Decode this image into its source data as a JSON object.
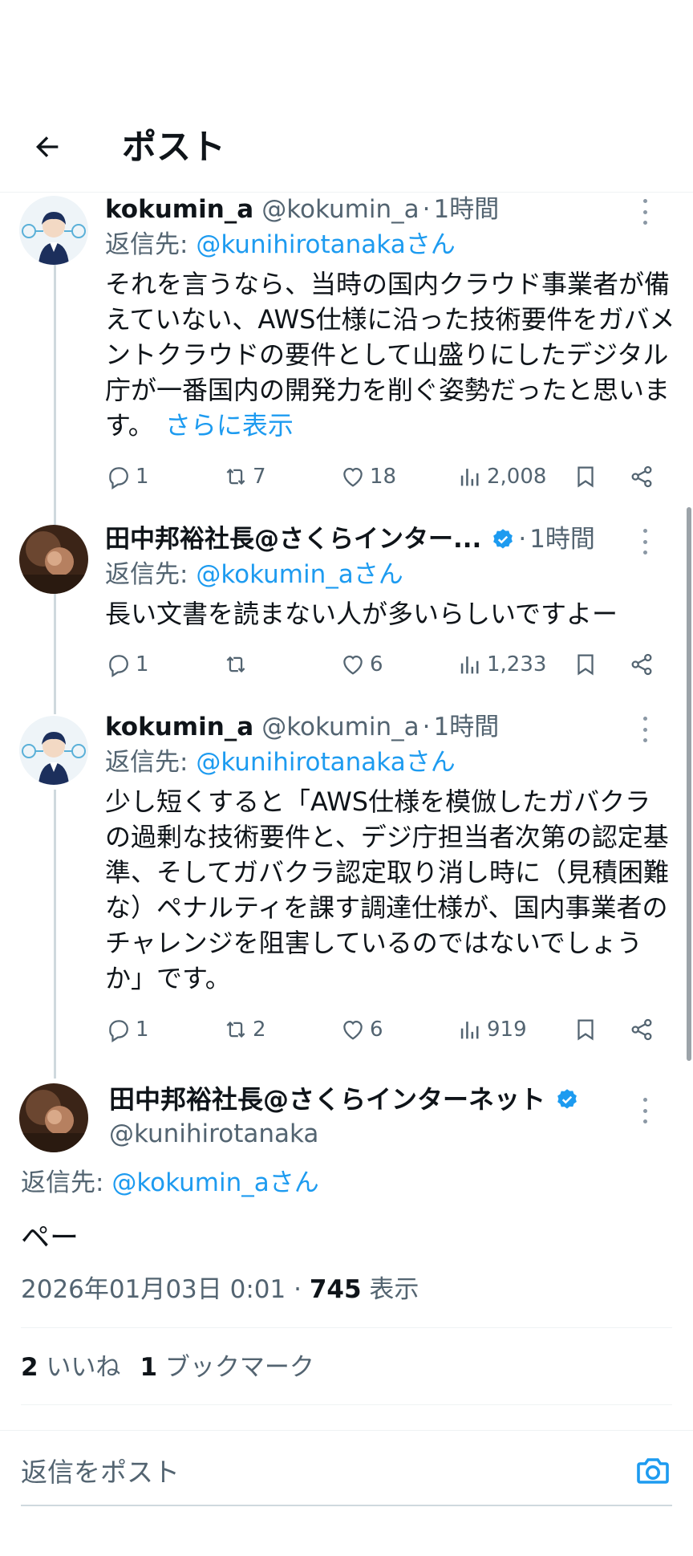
{
  "header": {
    "title": "ポスト",
    "back_icon": "arrow-left-icon"
  },
  "colors": {
    "link": "#1d9bf0",
    "muted": "#536471",
    "text": "#0f1419",
    "verified": "#1d9bf0"
  },
  "thread": [
    {
      "name": "kokumin_a",
      "handle": "@kokumin_a",
      "dot": "·",
      "time": "1時間",
      "reply_prefix": "返信先: ",
      "reply_mention": "@kunihirotanakaさん",
      "text": "それを言うなら、当時の国内クラウド事業者が備えていない、AWS仕様に沿った技術要件をガバメントクラウドの要件として山盛りにしたデジタル庁が一番国内の開発力を削ぐ姿勢だったと思います。",
      "show_more": "さらに表示",
      "replies": "1",
      "reposts": "7",
      "likes": "18",
      "views": "2,008"
    },
    {
      "name": "田中邦裕社長@さくらインター...",
      "handle": "",
      "dot": "·",
      "time": "1時間",
      "reply_prefix": "返信先: ",
      "reply_mention": "@kokumin_aさん",
      "text": "長い文書を読まない人が多いらしいですよー",
      "replies": "1",
      "reposts": "",
      "likes": "6",
      "views": "1,233"
    },
    {
      "name": "kokumin_a",
      "handle": "@kokumin_a",
      "dot": "·",
      "time": "1時間",
      "reply_prefix": "返信先: ",
      "reply_mention": "@kunihirotanakaさん",
      "text": "少し短くすると「AWS仕様を模倣したガバクラの過剰な技術要件と、デジ庁担当者次第の認定基準、そしてガバクラ認定取り消し時に（見積困難な）ペナルティを課す調達仕様が、国内事業者のチャレンジを阻害しているのではないでしょうか」です。",
      "replies": "1",
      "reposts": "2",
      "likes": "6",
      "views": "919"
    }
  ],
  "focus": {
    "name": "田中邦裕社長@さくらインターネット",
    "handle": "@kunihirotanaka",
    "reply_prefix": "返信先: ",
    "reply_mention": "@kokumin_aさん",
    "text": "ペー",
    "date": "2026年01月03日 0:01",
    "dot": "·",
    "views": "745",
    "views_label": "表示",
    "likes_count": "2",
    "likes_label": "いいね",
    "bookmarks_count": "1",
    "bookmarks_label": "ブックマーク"
  },
  "composer": {
    "placeholder": "返信をポスト",
    "camera_icon": "camera-icon"
  }
}
